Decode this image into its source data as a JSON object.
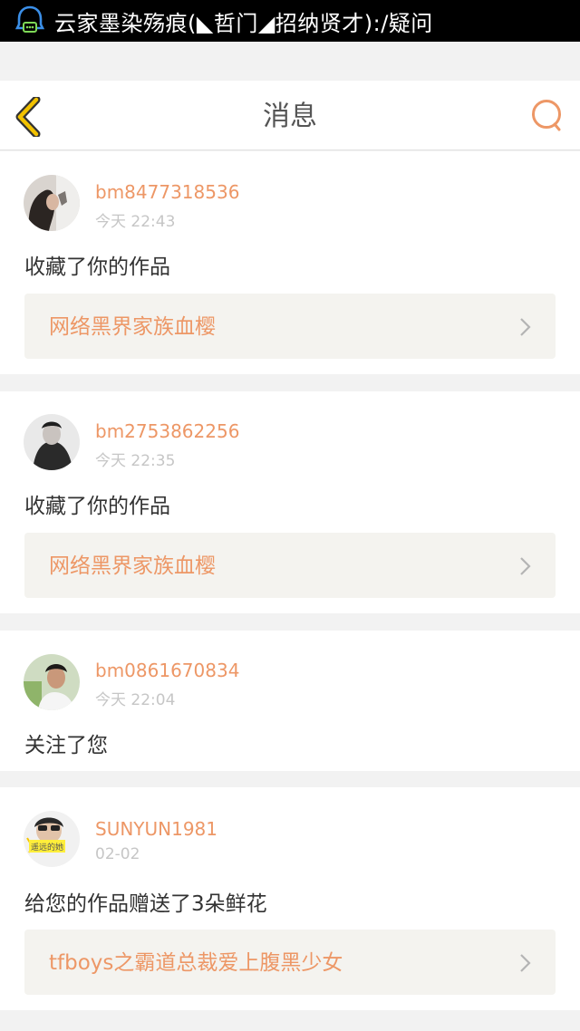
{
  "statusbar": {
    "text": "云家墨染殇痕(◣哲门◢招纳贤才):/疑问",
    "icon": "chat-notification-icon"
  },
  "header": {
    "title": "消息",
    "back_icon": "chevron-left-icon",
    "search_icon": "search-icon"
  },
  "colors": {
    "accent": "#ed9766",
    "back_icon_fill": "#f2c200",
    "background": "#f2f2f2",
    "card": "#ffffff",
    "link_bg": "#f4f3ef"
  },
  "messages": [
    {
      "username": "bm8477318536",
      "time": "今天 22:43",
      "action": "收藏了你的作品",
      "work": "网络黑界家族血樱"
    },
    {
      "username": "bm2753862256",
      "time": "今天 22:35",
      "action": "收藏了你的作品",
      "work": "网络黑界家族血樱"
    },
    {
      "username": "bm0861670834",
      "time": "今天 22:04",
      "action": "关注了您"
    },
    {
      "username": "SUNYUN1981",
      "time": "02-02",
      "action": "给您的作品赠送了3朵鲜花",
      "work": "tfboys之霸道总裁爱上腹黑少女",
      "avatar_badge": "遥远的她"
    }
  ]
}
